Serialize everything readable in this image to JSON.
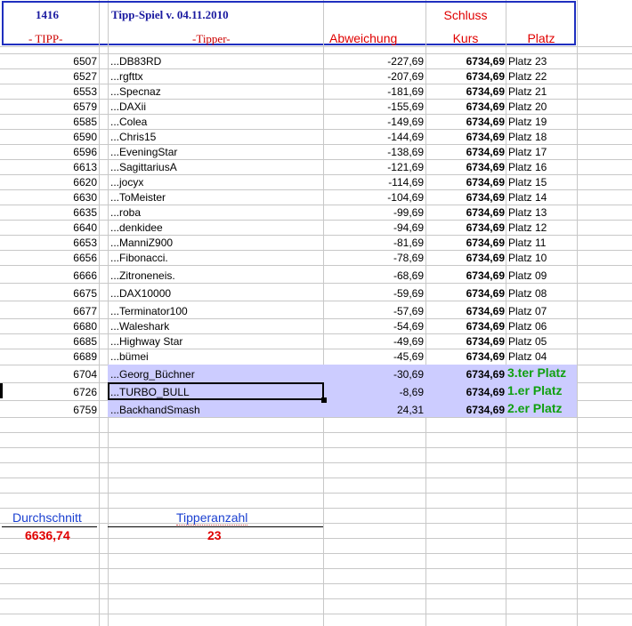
{
  "header": {
    "id": "1416",
    "title": "Tipp-Spiel v. 04.11.2010",
    "schluss": "Schluss",
    "col_tipp": "- TIPP-",
    "col_tipper": "-Tipper-",
    "col_abweichung": "Abweichung",
    "col_kurs": "Kurs",
    "col_platz": "Platz"
  },
  "rows": [
    {
      "tipp": "6507",
      "name": "...DB83RD",
      "abw": "-227,69",
      "kurs": "6734,69",
      "platz": "Platz 23"
    },
    {
      "tipp": "6527",
      "name": "...rgfttx",
      "abw": "-207,69",
      "kurs": "6734,69",
      "platz": "Platz 22"
    },
    {
      "tipp": "6553",
      "name": "...Specnaz",
      "abw": "-181,69",
      "kurs": "6734,69",
      "platz": "Platz 21"
    },
    {
      "tipp": "6579",
      "name": "...DAXii",
      "abw": "-155,69",
      "kurs": "6734,69",
      "platz": "Platz 20"
    },
    {
      "tipp": "6585",
      "name": "...Colea",
      "abw": "-149,69",
      "kurs": "6734,69",
      "platz": "Platz 19"
    },
    {
      "tipp": "6590",
      "name": "...Chris15",
      "abw": "-144,69",
      "kurs": "6734,69",
      "platz": "Platz 18"
    },
    {
      "tipp": "6596",
      "name": "...EveningStar",
      "abw": "-138,69",
      "kurs": "6734,69",
      "platz": "Platz 17"
    },
    {
      "tipp": "6613",
      "name": "...SagittariusA",
      "abw": "-121,69",
      "kurs": "6734,69",
      "platz": "Platz 16"
    },
    {
      "tipp": "6620",
      "name": "...jocyx",
      "abw": "-114,69",
      "kurs": "6734,69",
      "platz": "Platz 15"
    },
    {
      "tipp": "6630",
      "name": "...ToMeister",
      "abw": "-104,69",
      "kurs": "6734,69",
      "platz": "Platz 14"
    },
    {
      "tipp": "6635",
      "name": "...roba",
      "abw": "-99,69",
      "kurs": "6734,69",
      "platz": "Platz 13"
    },
    {
      "tipp": "6640",
      "name": "...denkidee",
      "abw": "-94,69",
      "kurs": "6734,69",
      "platz": "Platz 12"
    },
    {
      "tipp": "6653",
      "name": "...ManniZ900",
      "abw": "-81,69",
      "kurs": "6734,69",
      "platz": "Platz 11"
    },
    {
      "tipp": "6656",
      "name": "...Fibonacci.",
      "abw": "-78,69",
      "kurs": "6734,69",
      "platz": "Platz 10"
    },
    {
      "tipp": "6666",
      "name": "...Zitroneneis.",
      "abw": "-68,69",
      "kurs": "6734,69",
      "platz": "Platz 09"
    },
    {
      "tipp": "6675",
      "name": "...DAX10000",
      "abw": "-59,69",
      "kurs": "6734,69",
      "platz": "Platz 08"
    },
    {
      "tipp": "6677",
      "name": "...Terminator100",
      "abw": "-57,69",
      "kurs": "6734,69",
      "platz": "Platz 07"
    },
    {
      "tipp": "6680",
      "name": "...Waleshark",
      "abw": "-54,69",
      "kurs": "6734,69",
      "platz": "Platz 06"
    },
    {
      "tipp": "6685",
      "name": "...Highway Star",
      "abw": "-49,69",
      "kurs": "6734,69",
      "platz": "Platz 05"
    },
    {
      "tipp": "6689",
      "name": "...bümei",
      "abw": "-45,69",
      "kurs": "6734,69",
      "platz": "Platz 04"
    }
  ],
  "winners": [
    {
      "tipp": "6704",
      "name": "...Georg_Büchner",
      "abw": "-30,69",
      "kurs": "6734,69",
      "platz": "3.ter Platz"
    },
    {
      "tipp": "6726",
      "name": "...TURBO_BULL",
      "abw": "-8,69",
      "kurs": "6734,69",
      "platz": "1.er Platz"
    },
    {
      "tipp": "6759",
      "name": "...BackhandSmash",
      "abw": "24,31",
      "kurs": "6734,69",
      "platz": "2.er Platz"
    }
  ],
  "footer": {
    "avg_label": "Durchschnitt",
    "avg_value": "6636,74",
    "count_label": "Tipperanzahl",
    "count_value": "23"
  },
  "colors": {
    "highlight": "#ccccff",
    "header_border": "#1f2fbf",
    "accent_red": "#e00000",
    "winner_green": "#10a010"
  }
}
